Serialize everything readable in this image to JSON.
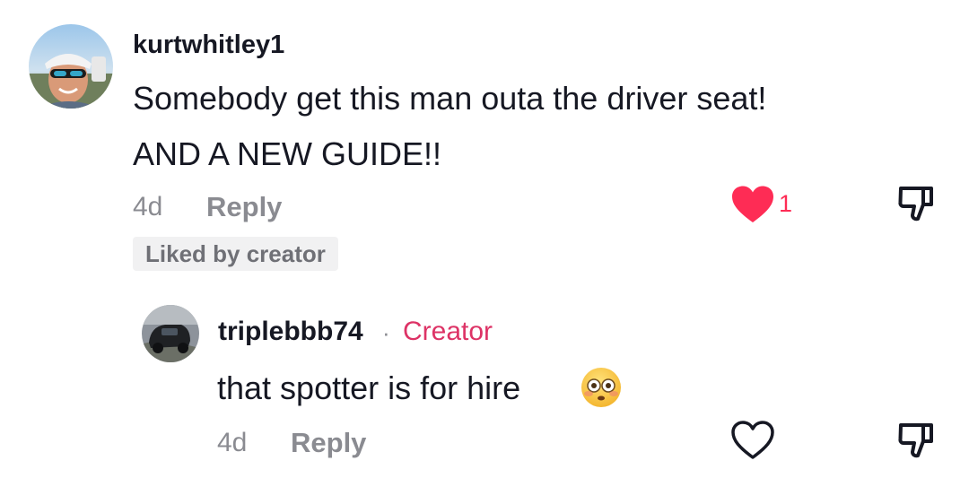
{
  "comment": {
    "username": "kurtwhitley1",
    "text_line1": "Somebody get this man outa the driver seat!",
    "text_line2": "AND A NEW GUIDE!!",
    "age": "4d",
    "reply_label": "Reply",
    "like_count": "1",
    "liked": true,
    "liked_by_creator_label": "Liked by creator"
  },
  "reply": {
    "username": "triplebbb74",
    "separator": "·",
    "creator_label": "Creator",
    "text": "that spotter is for hire",
    "emoji": "flushed-face-emoji",
    "age": "4d",
    "reply_label": "Reply",
    "liked": false
  },
  "colors": {
    "like_active": "#fe2c55",
    "creator_tag": "#dd3366",
    "muted_text": "#8a8b91"
  }
}
